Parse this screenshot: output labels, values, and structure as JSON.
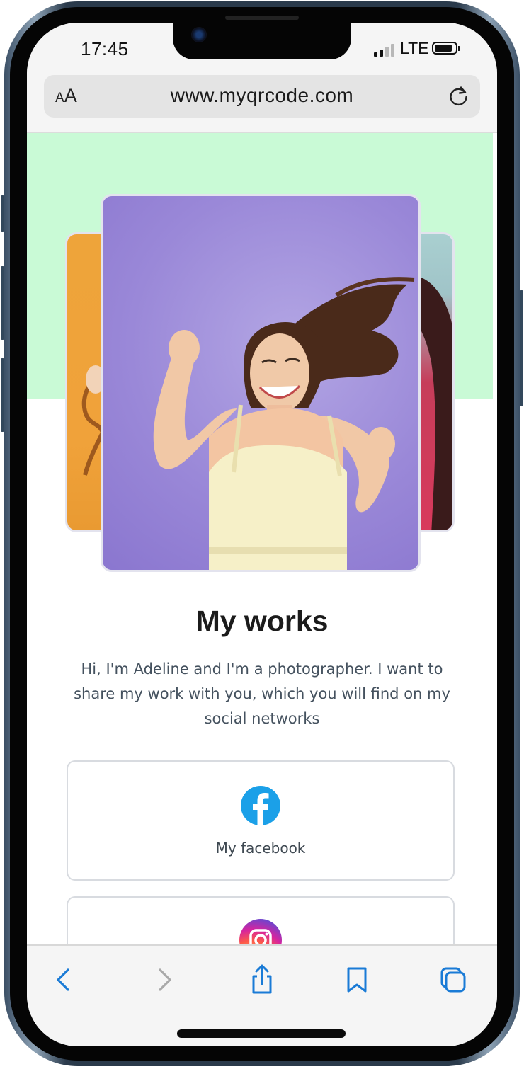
{
  "status_bar": {
    "time": "17:45",
    "network": "LTE"
  },
  "browser": {
    "text_size_small": "A",
    "text_size_large": "A",
    "url": "www.myqrcode.com"
  },
  "page": {
    "title": "My works",
    "description": "Hi, I'm Adeline and I'm a photographer. I want to share my work with you, which you will find on my social networks",
    "links": [
      {
        "label": "My facebook",
        "icon": "facebook-icon"
      },
      {
        "label": "",
        "icon": "instagram-icon"
      }
    ],
    "gallery": {
      "left_photo": "orange",
      "center_photo": "woman-dancing-purple",
      "right_photo": "red"
    }
  },
  "toolbar": {
    "icons": [
      "back-icon",
      "forward-icon",
      "share-icon",
      "bookmarks-icon",
      "tabs-icon"
    ]
  },
  "colors": {
    "header_bg": "#c9fad6",
    "accent": "#1a7bd6",
    "facebook": "#1877f2"
  }
}
